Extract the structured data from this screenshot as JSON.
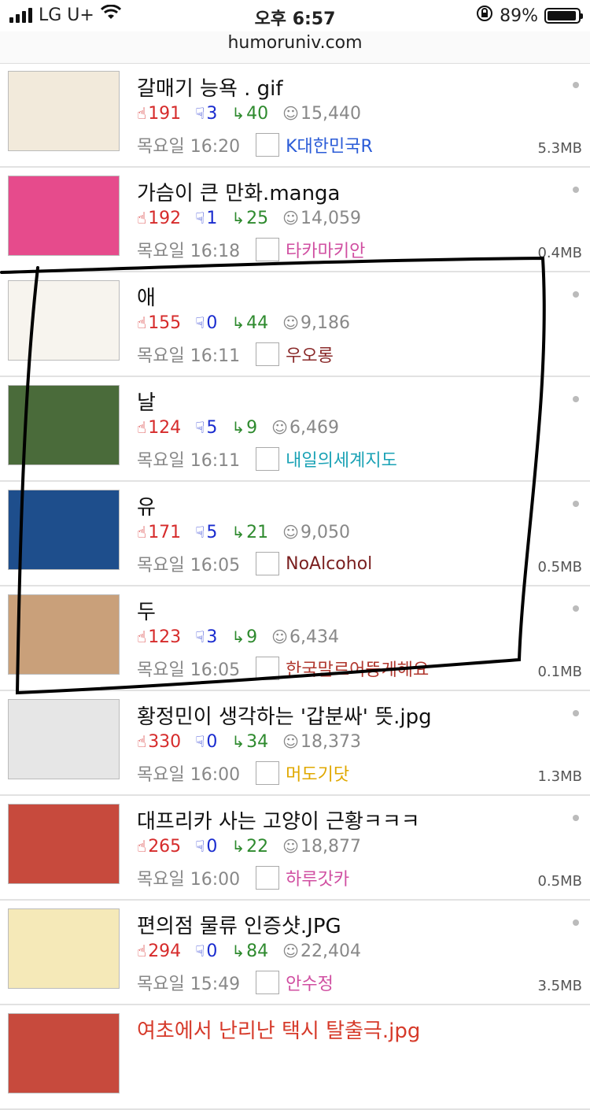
{
  "status": {
    "carrier": "LG U+",
    "time": "오후 6:57",
    "battery": "89%"
  },
  "url": "humoruniv.com",
  "items": [
    {
      "title": "갈매기 능욕 . gif",
      "up": "191",
      "down": "3",
      "reply": "40",
      "views": "15,440",
      "time": "목요일 16:20",
      "nick": "K대한민국R",
      "nick_color": "#2a5bd7",
      "size": "5.3MB",
      "thumb_bg": "#f2eadb",
      "title_red": false
    },
    {
      "title": "가슴이 큰 만화.manga",
      "up": "192",
      "down": "1",
      "reply": "25",
      "views": "14,059",
      "time": "목요일 16:18",
      "nick": "타카마키안",
      "nick_color": "#d04fa1",
      "size": "0.4MB",
      "thumb_bg": "#e64b8c",
      "title_red": false
    },
    {
      "title": "애",
      "up": "155",
      "down": "0",
      "reply": "44",
      "views": "9,186",
      "time": "목요일 16:11",
      "nick": "우오롱",
      "nick_color": "#8a2a2a",
      "size": "",
      "thumb_bg": "#f7f4ee",
      "title_red": false
    },
    {
      "title": "날",
      "up": "124",
      "down": "5",
      "reply": "9",
      "views": "6,469",
      "time": "목요일 16:11",
      "nick": "내일의세계지도",
      "nick_color": "#1aa2b5",
      "size": "",
      "thumb_bg": "#4a6b3a",
      "title_red": false
    },
    {
      "title": "유",
      "up": "171",
      "down": "5",
      "reply": "21",
      "views": "9,050",
      "time": "목요일 16:05",
      "nick": "NoAlcohol",
      "nick_color": "#7a1f1f",
      "size": "0.5MB",
      "thumb_bg": "#1e4e8c",
      "title_red": false
    },
    {
      "title": "두",
      "up": "123",
      "down": "3",
      "reply": "9",
      "views": "6,434",
      "time": "목요일 16:05",
      "nick": "한국말르어뚱게해요",
      "nick_color": "#b0372e",
      "size": "0.1MB",
      "thumb_bg": "#c9a07a",
      "title_red": false
    },
    {
      "title": "황정민이 생각하는 '갑분싸' 뜻.jpg",
      "up": "330",
      "down": "0",
      "reply": "34",
      "views": "18,373",
      "time": "목요일 16:00",
      "nick": "머도기닷",
      "nick_color": "#e0a800",
      "size": "1.3MB",
      "thumb_bg": "#e6e6e6",
      "title_red": false
    },
    {
      "title": "대프리카 사는 고양이 근황ㅋㅋㅋ",
      "up": "265",
      "down": "0",
      "reply": "22",
      "views": "18,877",
      "time": "목요일 16:00",
      "nick": "하루갓카",
      "nick_color": "#d04fa1",
      "size": "0.5MB",
      "thumb_bg": "#c74a3d",
      "title_red": false
    },
    {
      "title": "편의점 물류 인증샷.JPG",
      "up": "294",
      "down": "0",
      "reply": "84",
      "views": "22,404",
      "time": "목요일 15:49",
      "nick": "안수정",
      "nick_color": "#d04fa1",
      "size": "3.5MB",
      "thumb_bg": "#f5e9b8",
      "title_red": false
    },
    {
      "title": "여초에서 난리난 택시 탈출극.jpg",
      "up": "",
      "down": "",
      "reply": "",
      "views": "",
      "time": "",
      "nick": "",
      "nick_color": "#d04fa1",
      "size": "",
      "thumb_bg": "#c74a3d",
      "title_red": true
    }
  ]
}
